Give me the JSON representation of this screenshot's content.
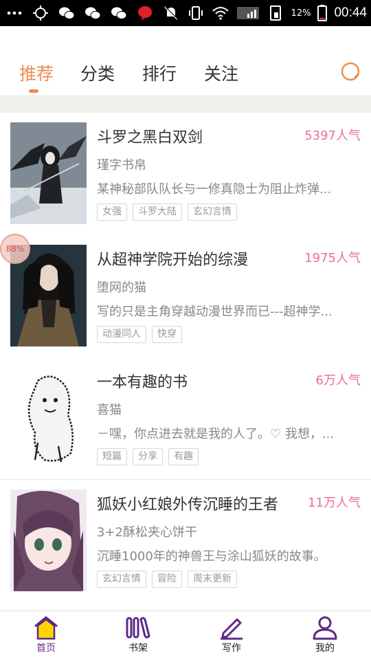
{
  "status_bar": {
    "icons": [
      "dots-icon",
      "location-icon",
      "wechat-icon",
      "wechat-icon",
      "wechat-icon",
      "notification-dot-icon",
      "mute-icon",
      "vibrate-icon",
      "wifi-icon",
      "signal-icon",
      "sim-icon"
    ],
    "battery_percent": "12%",
    "time": "00:44"
  },
  "top_tabs": {
    "items": [
      {
        "label": "推荐",
        "active": true
      },
      {
        "label": "分类",
        "active": false
      },
      {
        "label": "排行",
        "active": false
      },
      {
        "label": "关注",
        "active": false
      }
    ],
    "search_icon": "search-icon",
    "accent_color": "#f08a4b"
  },
  "floating_badge": "88%",
  "books": [
    {
      "title": "斗罗之黑白双剑",
      "popularity": "5397人气",
      "author": "瑾字书帛",
      "description": "某神秘部队队长与一修真隐士为阻止炸弹...",
      "tags": [
        "女强",
        "斗罗大陆",
        "玄幻言情"
      ]
    },
    {
      "title": "从超神学院开始的综漫",
      "popularity": "1975人气",
      "author": "堕网的猫",
      "description": "写的只是主角穿越动漫世界而已---超神学...",
      "tags": [
        "动漫同人",
        "快穿"
      ]
    },
    {
      "title": "一本有趣的书",
      "popularity": "6万人气",
      "author": "喜猫",
      "description": "－嘿，你点进去就是我的人了。♡ 我想，...",
      "tags": [
        "短篇",
        "分享",
        "有趣"
      ]
    },
    {
      "title": "狐妖小红娘外传沉睡的王者",
      "popularity": "11万人气",
      "author": "3+2酥松夹心饼干",
      "description": "沉睡1000年的神兽王与涂山狐妖的故事。",
      "tags": [
        "玄幻言情",
        "冒险",
        "周末更新"
      ]
    }
  ],
  "bottom_nav": {
    "items": [
      {
        "label": "首页",
        "icon": "home-icon",
        "active": true
      },
      {
        "label": "书架",
        "icon": "bookshelf-icon",
        "active": false
      },
      {
        "label": "写作",
        "icon": "write-icon",
        "active": false
      },
      {
        "label": "我的",
        "icon": "profile-icon",
        "active": false
      }
    ]
  },
  "colors": {
    "popularity": "#ea6aa0",
    "nav_active": "#6a2a8a",
    "nav_icon": "#5b2a86",
    "home_fill": "#ffd400"
  }
}
